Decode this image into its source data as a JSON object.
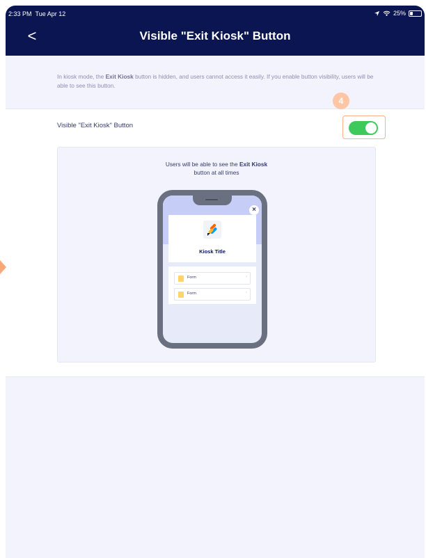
{
  "status_bar": {
    "time": "2:33 PM",
    "date": "Tue Apr 12",
    "battery_text": "25%",
    "battery_level_percent": 25
  },
  "nav": {
    "back_icon": "chevron-left-icon",
    "back_glyph": "<",
    "title": "Visible \"Exit Kiosk\" Button"
  },
  "description": {
    "prefix": "In kiosk mode, the ",
    "bold": "Exit Kiosk",
    "suffix": " button is hidden, and users cannot access it easily. If you enable button visibility, users will be able to see this button."
  },
  "setting": {
    "label": "Visible \"Exit Kiosk\" Button",
    "enabled": true,
    "step_badge": "4"
  },
  "preview": {
    "text_prefix": "Users will be able to see the ",
    "text_bold": "Exit Kiosk",
    "text_suffix": " button at all times",
    "kiosk_title": "Kiosk Title",
    "close_glyph": "×",
    "forms": [
      {
        "label": "Form"
      },
      {
        "label": "Form"
      }
    ]
  },
  "colors": {
    "header_bg": "#0a1551",
    "toggle_on": "#3dca5b",
    "highlight": "#ffb386",
    "page_bg": "#f3f3fd"
  }
}
